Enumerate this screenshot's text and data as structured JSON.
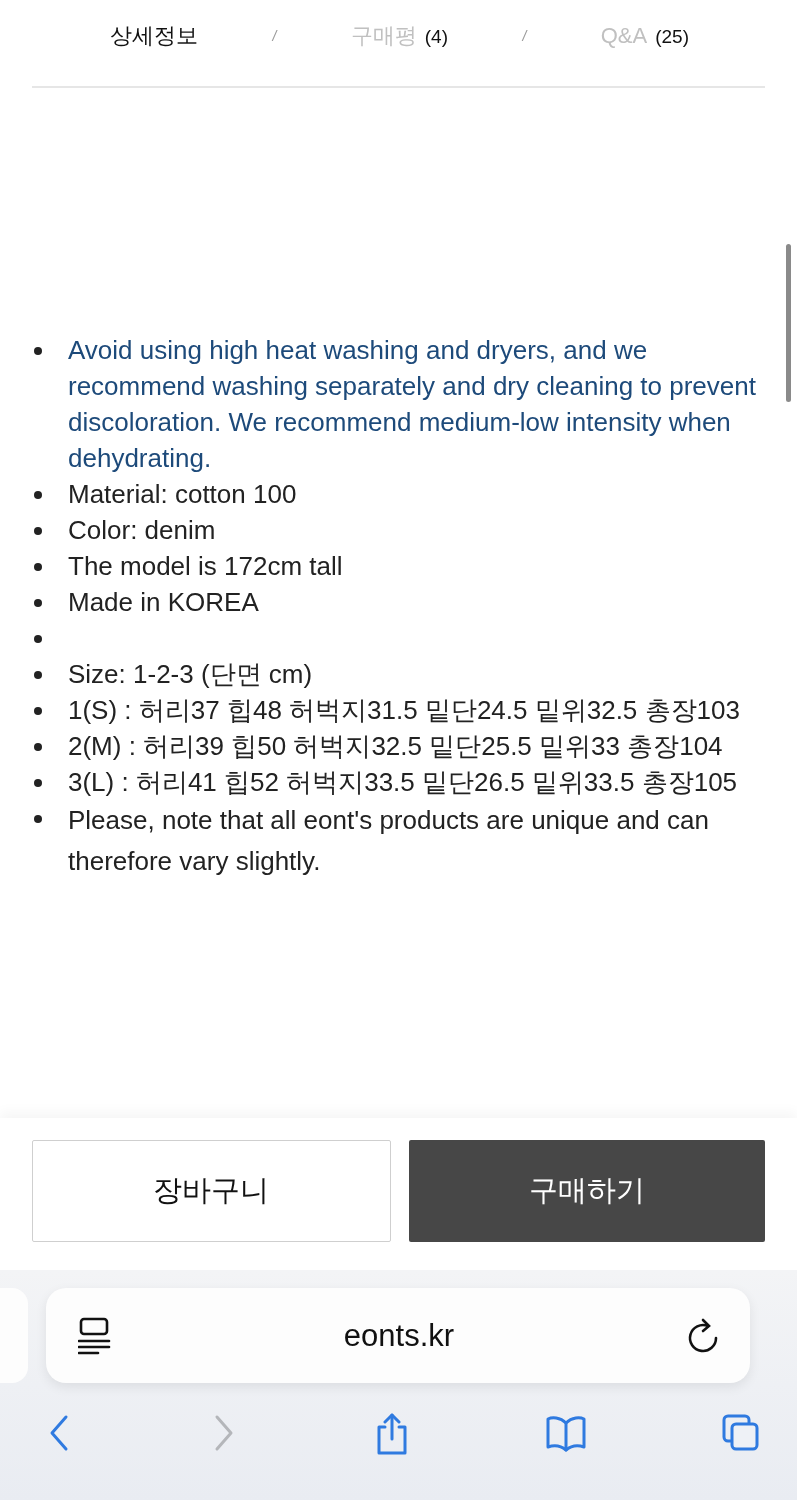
{
  "tabs": [
    {
      "label": "상세정보",
      "selected": true
    },
    {
      "label": "구매평",
      "count": "(4)",
      "selected": false
    },
    {
      "label": "Q&A",
      "count": "(25)",
      "selected": false
    }
  ],
  "tab_separators": [
    "/",
    "/"
  ],
  "details": [
    {
      "text": "Avoid using high heat washing and dryers, and we recommend washing separately and dry cleaning to prevent discoloration. We recommend medium-low intensity when dehydrating.",
      "color": "#1d4a7a"
    },
    {
      "text": "Material: cotton 100",
      "color": "#222222"
    },
    {
      "text": "Color: denim",
      "color": "#222222"
    },
    {
      "text": "The model is 172cm tall",
      "color": "#222222"
    },
    {
      "text": "Made in KOREA",
      "color": "#222222"
    },
    {
      "color": "#222222"
    },
    {
      "text": "Size: 1-2-3 (단면 cm)",
      "color": "#222222"
    },
    {
      "text": "1(S) : 허리37 힙48 허벅지31.5 밑단24.5 밑위32.5 총장103",
      "color": "#222222"
    },
    {
      "text": "2(M) : 허리39 힙50 허벅지32.5 밑단25.5 밑위33 총장104",
      "color": "#222222"
    },
    {
      "text": "3(L) : 허리41 힙52 허벅지33.5 밑단26.5 밑위33.5 총장105",
      "color": "#222222"
    },
    {
      "text": "Please, note that all eont's products are unique and can therefore vary slightly.",
      "color": "#222222",
      "loose": true
    }
  ],
  "actions": [
    {
      "label": "장바구니",
      "kind": "secondary"
    },
    {
      "label": "구매하기",
      "kind": "primary"
    }
  ],
  "address_bar": {
    "url": "eonts.kr"
  },
  "toolbar": [
    {
      "kind": "back",
      "disabled": false
    },
    {
      "kind": "forward",
      "disabled": true
    },
    {
      "kind": "share",
      "disabled": false
    },
    {
      "kind": "bookmarks",
      "disabled": false
    },
    {
      "kind": "tabs",
      "disabled": false
    }
  ]
}
